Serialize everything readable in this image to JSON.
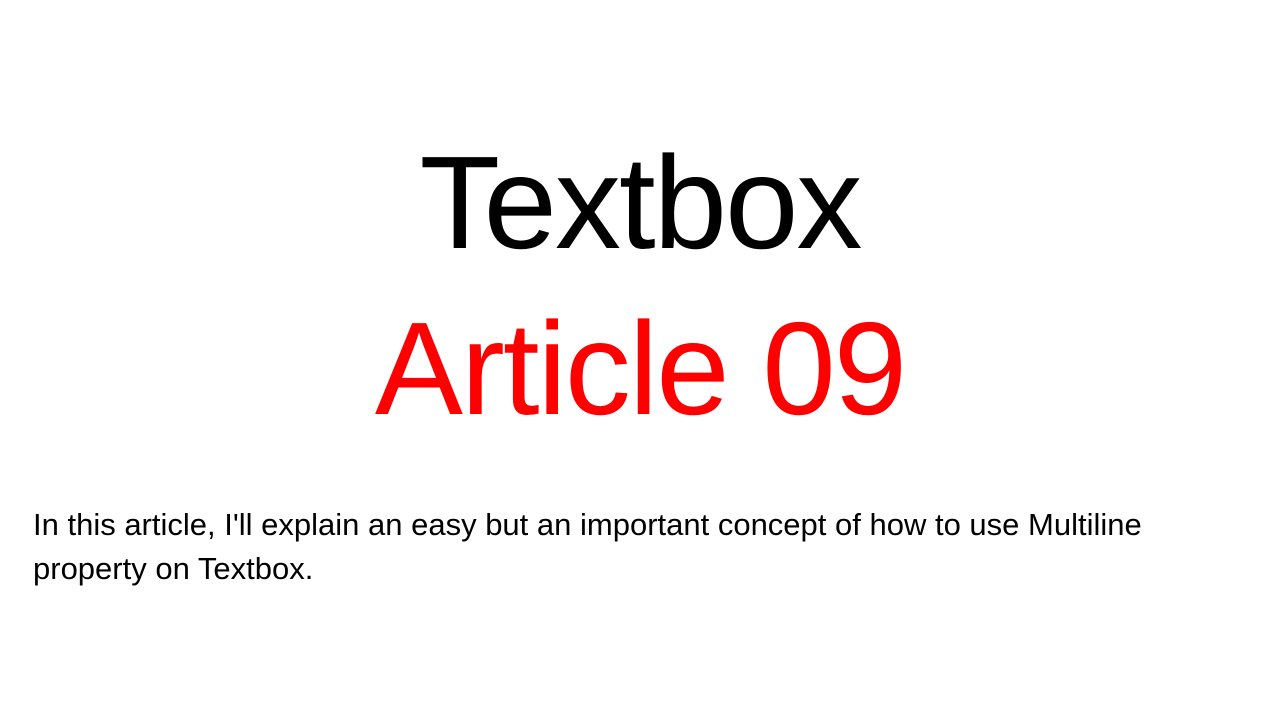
{
  "slide": {
    "title": "Textbox",
    "subtitle": "Article 09",
    "body": "In this article, I'll explain an easy but an important concept of how to use Multiline property on Textbox."
  },
  "colors": {
    "background": "#ffffff",
    "title": "#000000",
    "subtitle": "#ff0000",
    "body": "#000000"
  }
}
